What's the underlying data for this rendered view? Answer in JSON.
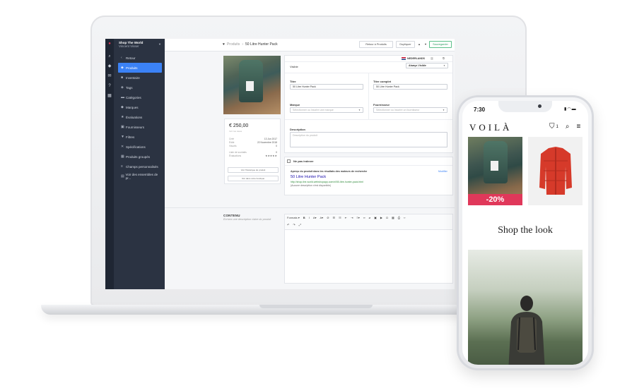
{
  "admin": {
    "store_name": "Shop The World",
    "user_name": "Vincent Visser",
    "nav": [
      {
        "label": "Retour",
        "icon": "chevron-left-icon"
      },
      {
        "label": "Produits",
        "icon": "tag-icon",
        "active": true
      },
      {
        "label": "Inventaire",
        "icon": "box-icon"
      },
      {
        "label": "Tags",
        "icon": "tag-icon"
      },
      {
        "label": "Catégories",
        "icon": "folder-icon"
      },
      {
        "label": "Marques",
        "icon": "bookmark-icon"
      },
      {
        "label": "Évaluations",
        "icon": "star-icon"
      },
      {
        "label": "Fournisseurs",
        "icon": "truck-icon"
      },
      {
        "label": "Filtres",
        "icon": "filter-icon"
      },
      {
        "label": "Spécifications",
        "icon": "wrench-icon"
      },
      {
        "label": "Produits groupés",
        "icon": "grid-icon"
      },
      {
        "label": "Champs personnalisés",
        "icon": "list-icon"
      },
      {
        "label": "Voir des ensembles de pr...",
        "icon": "book-icon"
      }
    ],
    "breadcrumb": {
      "parent": "Produits",
      "current": "50 Litre Hunter Pack"
    },
    "toolbar": {
      "back": "Retour à Produits",
      "duplicate": "Dupliquer",
      "save": "Sauvegarder"
    },
    "language": "NEDERLANDS",
    "visible_label": "Visible",
    "visible_value": "Always Visible",
    "price": "€ 250,00",
    "price_sub": "Incl. les taxes",
    "stats": [
      {
        "label": "Créé",
        "value": "13 Jun 2017"
      },
      {
        "label": "Édité",
        "value": "22 Novembre 2018"
      },
      {
        "label": "Visuels",
        "value": "0"
      },
      {
        "label": "Liste de souhaits",
        "value": "0"
      },
      {
        "label": "Évaluations",
        "value": "★★★★★"
      }
    ],
    "btn_history": "Voir l'historique du produit",
    "btn_store": "Voir dans votre boutique",
    "fields": {
      "title_label": "Titre",
      "title_value": "50 Litre Hunter Pack",
      "full_title_label": "Titre complet",
      "full_title_value": "50 Litre Hunter Pack",
      "brand_label": "Marque",
      "brand_placeholder": "Sélectionner ou inscrire une marque",
      "supplier_label": "Fournisseur",
      "supplier_placeholder": "Sélectionner ou inscrire un fournisseur",
      "description_label": "Description",
      "description_placeholder": "Description du produit"
    },
    "seo": {
      "noindex_label": "Ne pas indexer",
      "heading": "Aperçu du produit dans les résultats des moteurs de recherche",
      "edit": "Modifier",
      "title": "50 Litre Hunter Pack",
      "url": "http://shop-the-world.webshopapp.com/nl/50-litre-hunter-pack.html",
      "desc": "(Aucune description n'est disponible)"
    },
    "content_label": "CONTENU",
    "content_desc": "Écrivez une description claire du produit",
    "editor_formats": "Formats"
  },
  "phone": {
    "time": "7:30",
    "logo": "VOILÀ",
    "cart_count": "1",
    "sale": "-20%",
    "shop_the_look": "Shop the look"
  }
}
